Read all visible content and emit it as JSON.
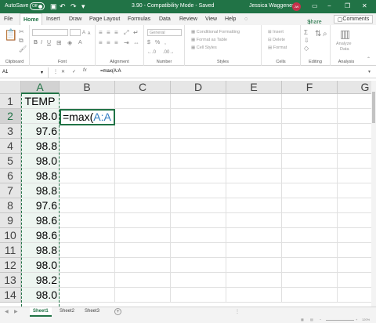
{
  "titlebar": {
    "autosave_label": "AutoSave",
    "autosave_state": "Off",
    "doc_title": "3.90  -  Compatibility Mode  -  Saved",
    "user_name": "Jessica Waggener",
    "user_initials": "JW"
  },
  "menu": {
    "tabs": [
      "File",
      "Home",
      "Insert",
      "Draw",
      "Page Layout",
      "Formulas",
      "Data",
      "Review",
      "View",
      "Help"
    ],
    "share": "Share",
    "comments": "Comments"
  },
  "ribbon": {
    "groups": [
      "Clipboard",
      "Font",
      "Alignment",
      "Number",
      "Styles",
      "Cells",
      "Editing",
      "Analysis"
    ],
    "number_format": "General",
    "styles_items": [
      "Conditional Formatting",
      "Format as Table",
      "Cell Styles"
    ],
    "cells_items": [
      "Insert",
      "Delete",
      "Format"
    ],
    "analysis_button": [
      "Analyze",
      "Data"
    ]
  },
  "formula_bar": {
    "name_box": "A1",
    "fx": "fx",
    "formula": "=max(A:A"
  },
  "sheet": {
    "columns": [
      "A",
      "B",
      "C",
      "D",
      "E",
      "F",
      "G"
    ],
    "rows": [
      "1",
      "2",
      "3",
      "4",
      "5",
      "6",
      "7",
      "8",
      "9",
      "10",
      "11",
      "12",
      "13",
      "14"
    ],
    "col_a": [
      "TEMP",
      "98.0",
      "97.6",
      "98.8",
      "98.0",
      "98.8",
      "98.8",
      "97.6",
      "98.6",
      "98.6",
      "98.8",
      "98.0",
      "98.2",
      "98.0"
    ],
    "edit_prefix": "=max(",
    "edit_ref": "A:A"
  },
  "sheet_tabs": [
    "Sheet1",
    "Sheet2",
    "Sheet3"
  ],
  "status": {
    "zoom": "120%"
  }
}
